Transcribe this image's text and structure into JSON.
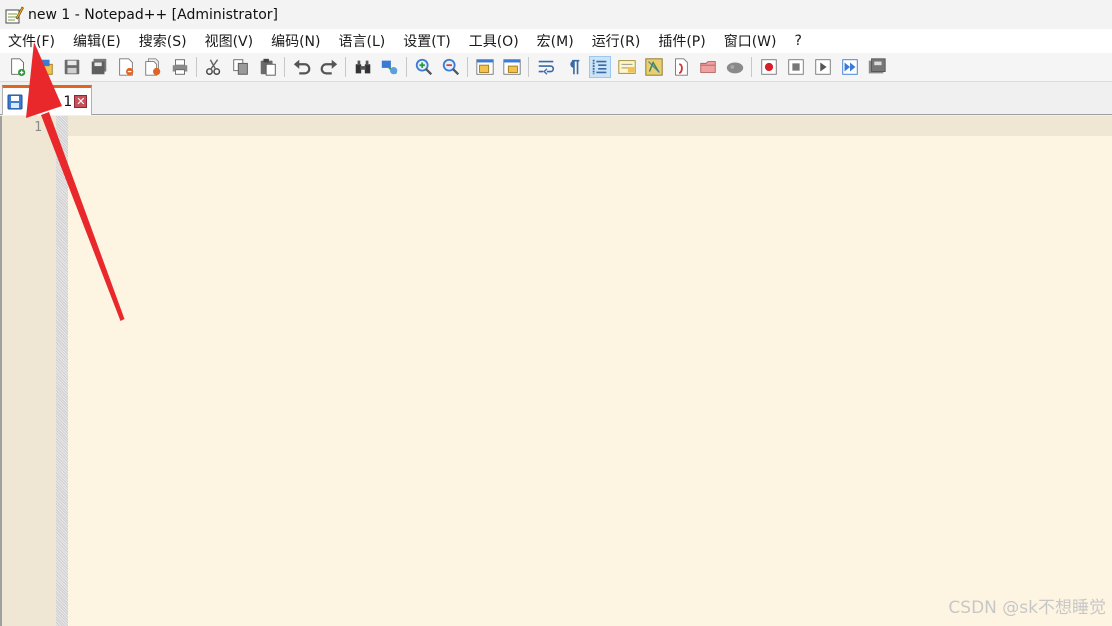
{
  "window": {
    "title": "new 1 - Notepad++ [Administrator]"
  },
  "menu": {
    "items": [
      "文件(F)",
      "编辑(E)",
      "搜索(S)",
      "视图(V)",
      "编码(N)",
      "语言(L)",
      "设置(T)",
      "工具(O)",
      "宏(M)",
      "运行(R)",
      "插件(P)",
      "窗口(W)",
      "?"
    ]
  },
  "toolbar": {
    "buttons": [
      "new-file-icon",
      "open-file-icon",
      "save-icon",
      "save-all-icon",
      "close-icon",
      "close-all-icon",
      "print-icon",
      "|",
      "cut-icon",
      "copy-icon",
      "paste-icon",
      "|",
      "undo-icon",
      "redo-icon",
      "|",
      "find-icon",
      "replace-icon",
      "|",
      "zoom-in-icon",
      "zoom-out-icon",
      "|",
      "sync-vertical-icon",
      "sync-horizontal-icon",
      "|",
      "word-wrap-icon",
      "show-all-chars-icon",
      "indent-guide-icon",
      "doc-map-icon",
      "function-list-icon",
      "doc-switcher-icon",
      "folder-workspace-icon",
      "monitoring-icon",
      "|",
      "record-macro-icon",
      "stop-macro-icon",
      "play-macro-icon",
      "run-macro-multiple-icon",
      "save-macro-icon"
    ],
    "active_button": "indent-guide-icon"
  },
  "tab": {
    "label": "new 1",
    "close_symbol": "✕",
    "accent_color": "#e06524"
  },
  "editor": {
    "line_numbers": [
      "1"
    ],
    "background_color": "#fdf5e2"
  },
  "watermark": "CSDN @sk不想睡觉",
  "annotation": {
    "color": "#e8282b",
    "points_to": "menu-file"
  }
}
